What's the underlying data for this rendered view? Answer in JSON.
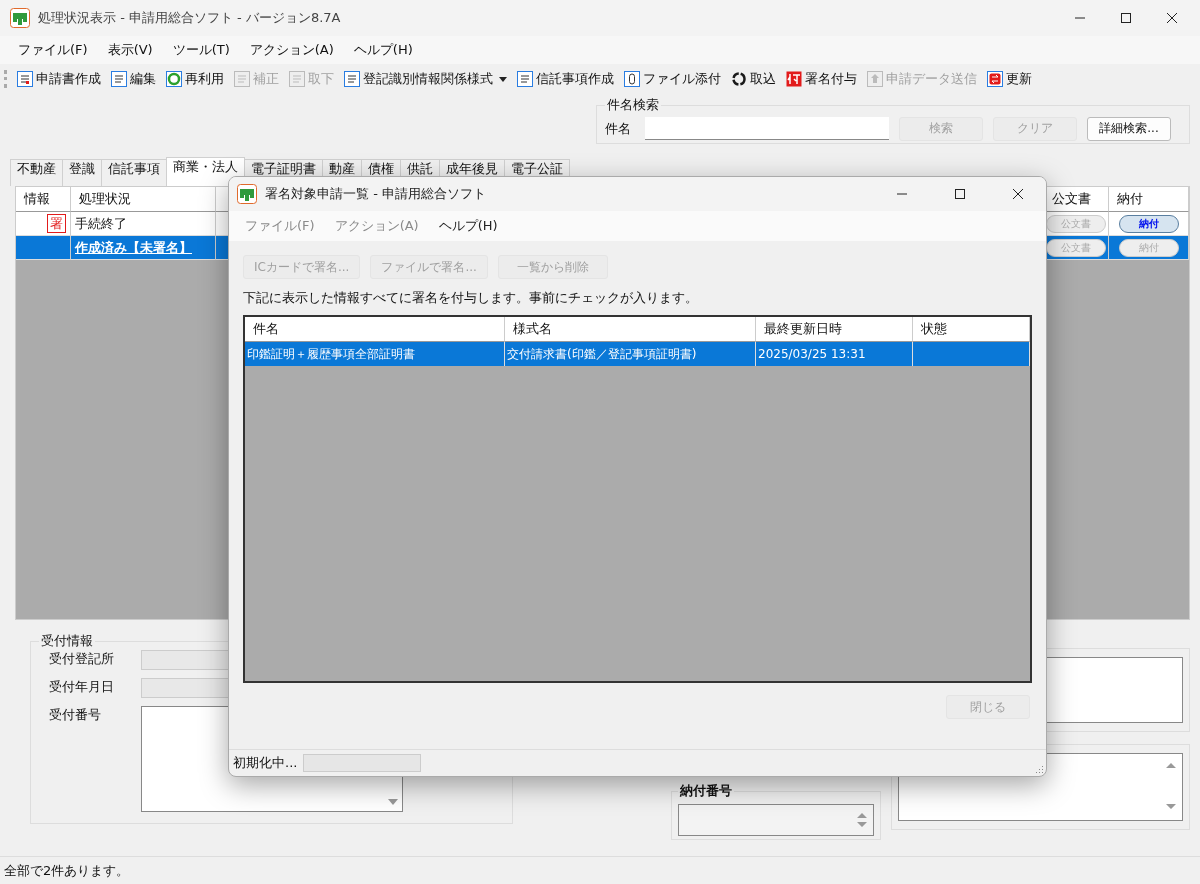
{
  "window": {
    "title": "処理状況表示 - 申請用総合ソフト - バージョン8.7A"
  },
  "menu": [
    "ファイル(F)",
    "表示(V)",
    "ツール(T)",
    "アクション(A)",
    "ヘルプ(H)"
  ],
  "toolbar": [
    {
      "label": "申請書作成",
      "disabled": false
    },
    {
      "label": "編集",
      "disabled": false
    },
    {
      "label": "再利用",
      "disabled": false
    },
    {
      "label": "補正",
      "disabled": true
    },
    {
      "label": "取下",
      "disabled": true
    },
    {
      "label": "登記識別情報関係様式",
      "disabled": false,
      "dropdown": true
    },
    {
      "label": "信託事項作成",
      "disabled": false
    },
    {
      "label": "ファイル添付",
      "disabled": false
    },
    {
      "label": "取込",
      "disabled": false
    },
    {
      "label": "署名付与",
      "disabled": false
    },
    {
      "label": "申請データ送信",
      "disabled": true
    },
    {
      "label": "更新",
      "disabled": false
    }
  ],
  "search": {
    "group_label": "件名検索",
    "field_label": "件名",
    "buttons": [
      {
        "label": "検索",
        "disabled": true
      },
      {
        "label": "クリア",
        "disabled": true
      },
      {
        "label": "詳細検索...",
        "disabled": false
      }
    ]
  },
  "tabs": [
    {
      "label": "不動産",
      "selected": false
    },
    {
      "label": "登識",
      "selected": false
    },
    {
      "label": "信託事項",
      "selected": false
    },
    {
      "label": "商業・法人",
      "selected": true
    },
    {
      "label": "電子証明書",
      "selected": false
    },
    {
      "label": "動産",
      "selected": false
    },
    {
      "label": "債権",
      "selected": false
    },
    {
      "label": "供託",
      "selected": false
    },
    {
      "label": "成年後見",
      "selected": false
    },
    {
      "label": "電子公証",
      "selected": false
    }
  ],
  "table": {
    "columns": [
      "情報",
      "処理状況",
      "",
      "公文書",
      "納付"
    ],
    "rows": [
      {
        "selected": false,
        "info": "署",
        "status": "手続終了",
        "official_doc": {
          "label": "公文書",
          "disabled": true
        },
        "payment": {
          "label": "納付",
          "disabled": false
        }
      },
      {
        "selected": true,
        "status": "作成済み【未署名】",
        "official_doc": {
          "label": "公文書",
          "disabled": true
        },
        "payment": {
          "label": "納付",
          "disabled": true
        }
      }
    ]
  },
  "receipt_info": {
    "label": "受付情報",
    "fields": [
      {
        "label": "受付登記所",
        "kind": "text"
      },
      {
        "label": "受付年月日",
        "kind": "text"
      },
      {
        "label": "受付番号",
        "kind": "textarea"
      }
    ]
  },
  "payment_number": {
    "label": "納付番号"
  },
  "status_bar": "全部で2件あります。",
  "dialog": {
    "title": "署名対象申請一覧 - 申請用総合ソフト",
    "menu": [
      {
        "label": "ファイル(F)",
        "disabled": true
      },
      {
        "label": "アクション(A)",
        "disabled": true
      },
      {
        "label": "ヘルプ(H)",
        "disabled": false
      }
    ],
    "buttons": [
      {
        "label": "ICカードで署名...",
        "disabled": true
      },
      {
        "label": "ファイルで署名...",
        "disabled": true
      },
      {
        "label": "一覧から削除",
        "disabled": true
      }
    ],
    "message": "下記に表示した情報すべてに署名を付与します。事前にチェックが入ります。",
    "columns": [
      "件名",
      "様式名",
      "最終更新日時",
      "状態"
    ],
    "rows": [
      {
        "selected": true,
        "cells": [
          "印鑑証明＋履歴事項全部証明書",
          "交付請求書(印鑑／登記事項証明書)",
          "2025/03/25 13:31",
          ""
        ]
      }
    ],
    "close_button": {
      "label": "閉じる",
      "disabled": true
    },
    "status_text": "初期化中..."
  }
}
